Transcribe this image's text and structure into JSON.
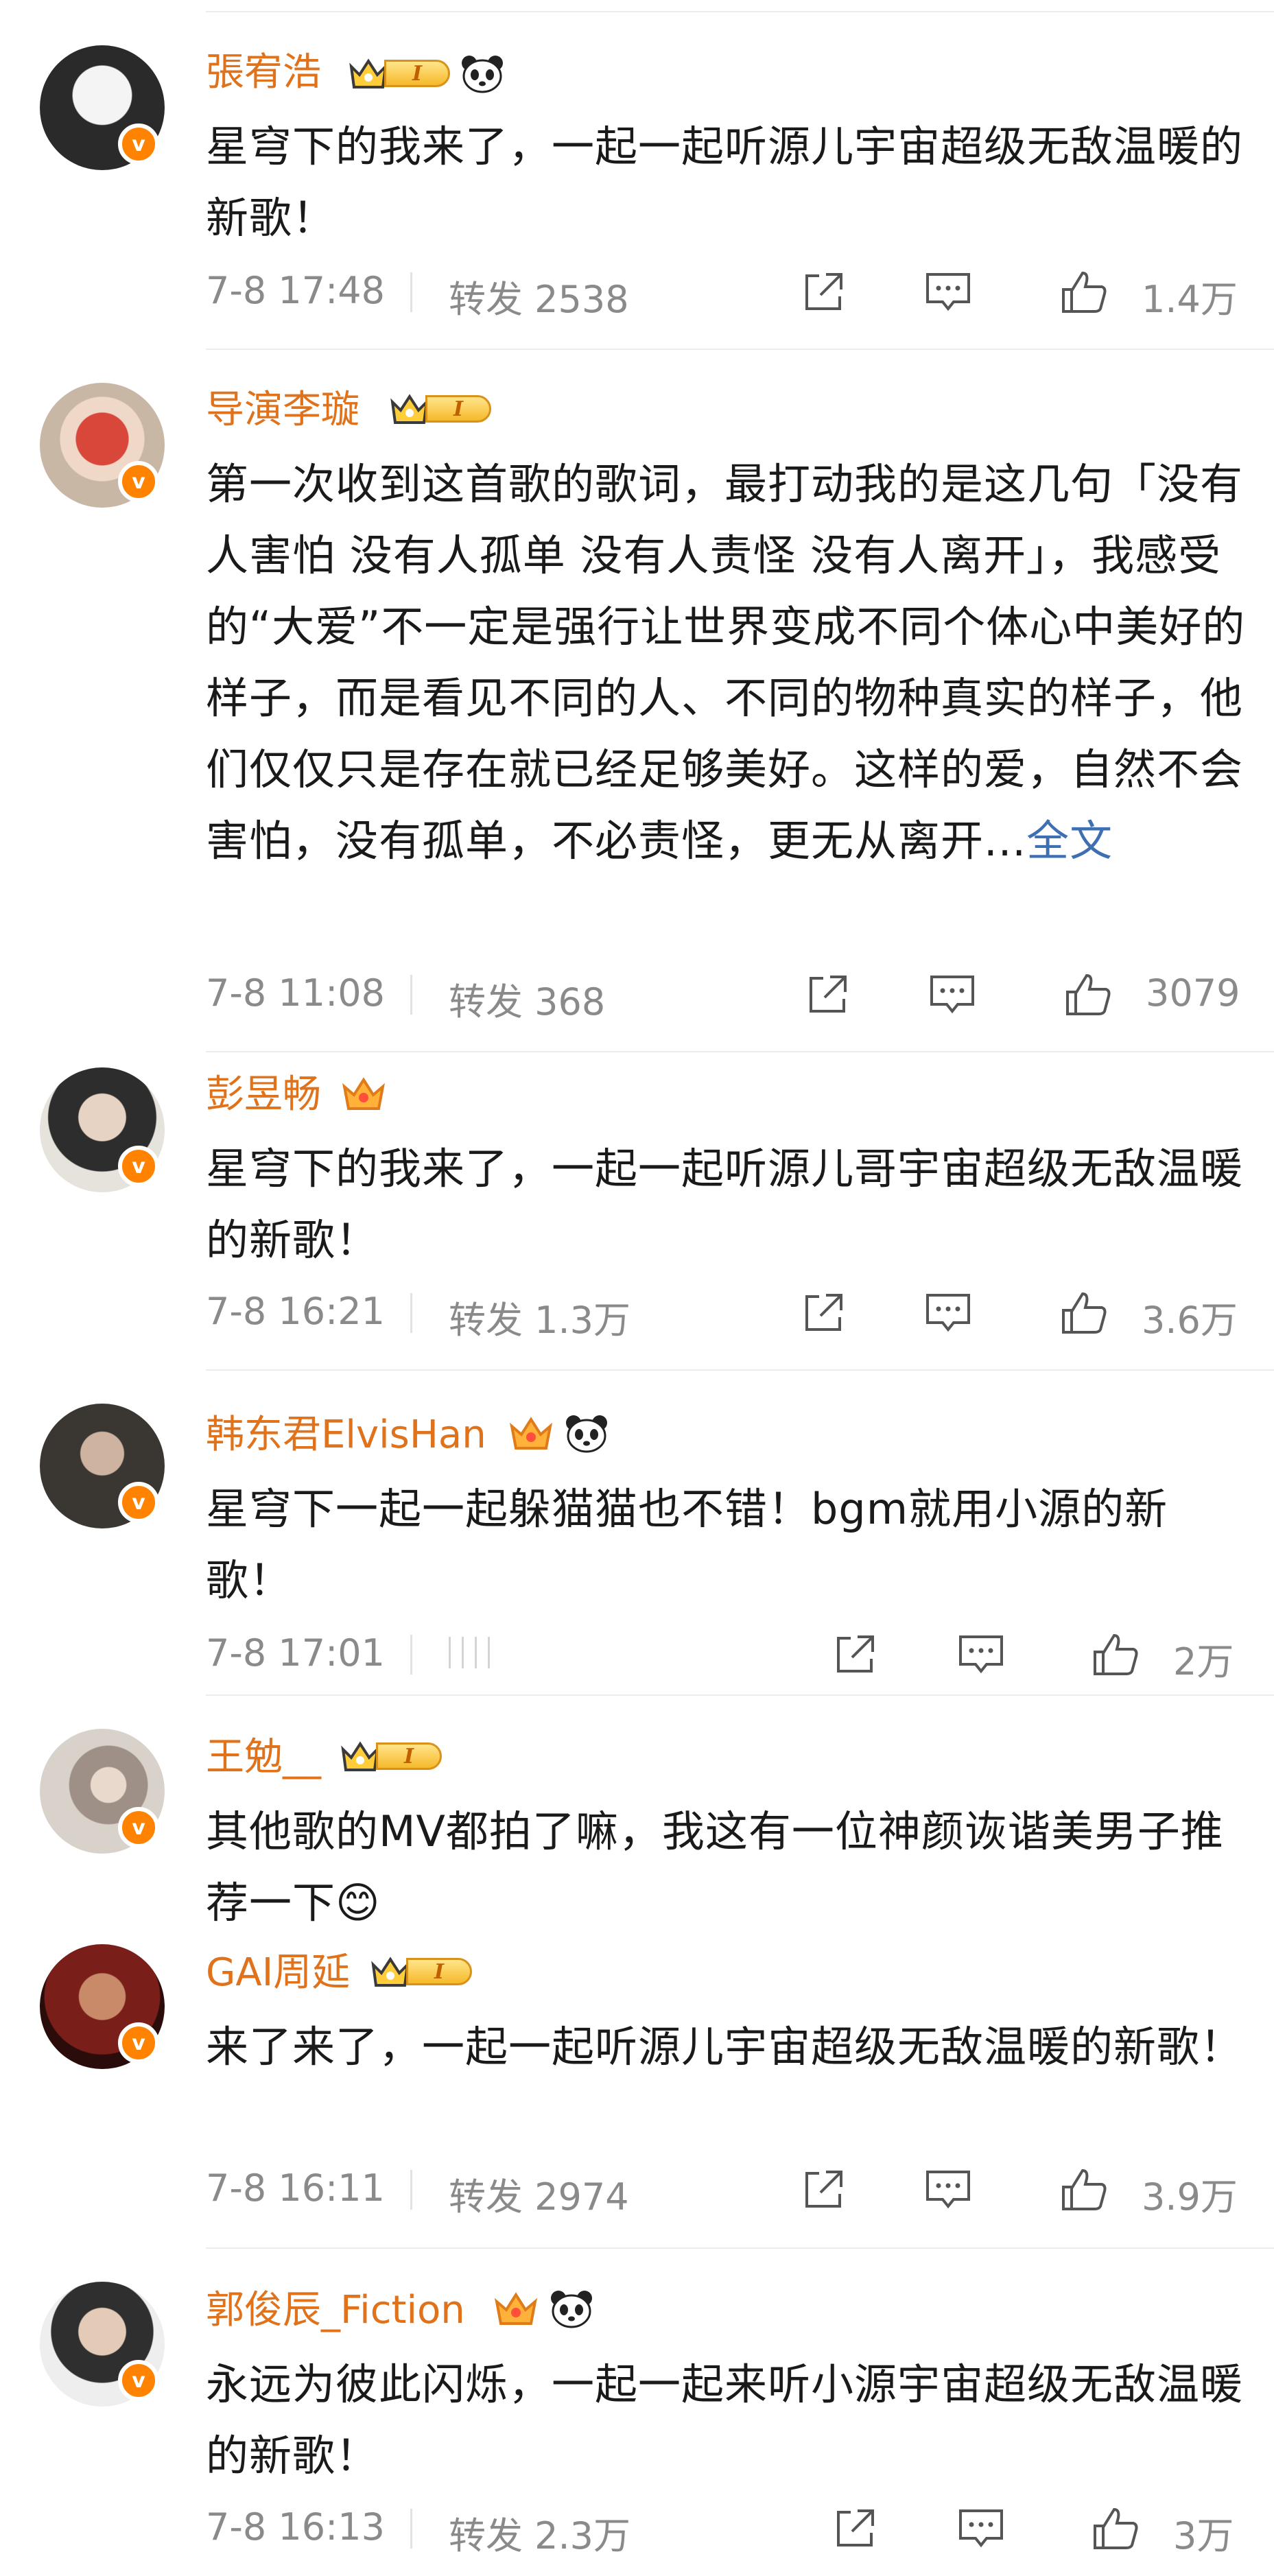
{
  "comments": [
    {
      "name": "張宥浩",
      "badge": "I",
      "panda": true,
      "text": "星穹下的我来了，一起一起听源儿宇宙超级无敌温暖的新歌！",
      "time": "7-8 17:48",
      "repost": "转发 2538",
      "likes": "1.4万"
    },
    {
      "name": "导演李璇",
      "badge": "I",
      "panda": false,
      "text": "第一次收到这首歌的歌词，最打动我的是这几句「没有人害怕 没有人孤单 没有人责怪 没有人离开」，我感受的“大爱”不一定是强行让世界变成不同个体心中美好的样子，而是看见不同的人、不同的物种真实的样子，他们仅仅只是存在就已经足够美好。这样的爱，自然不会害怕，没有孤单，不必责怪，更无从离开...",
      "more": "全文",
      "time": "7-8 11:08",
      "repost": "转发 368",
      "likes": "3079"
    },
    {
      "name": "彭昱畅",
      "badge": "",
      "panda": false,
      "text": "星穹下的我来了，一起一起听源儿哥宇宙超级无敌温暖的新歌！",
      "time": "7-8 16:21",
      "repost": "转发 1.3万",
      "likes": "3.6万"
    },
    {
      "name": "韩东君ElvisHan",
      "badge": "",
      "panda": true,
      "text": "星穹下一起一起躲猫猫也不错！bgm就用小源的新歌！",
      "time": "7-8 17:01",
      "repost": "",
      "likes": "2万"
    },
    {
      "name": "王勉__",
      "badge": "I",
      "panda": false,
      "text": "其他歌的MV都拍了嘛，我这有一位神颜诙谐美男子推荐一下😊"
    },
    {
      "name": "GAI周延",
      "badge": "I",
      "panda": false,
      "text": "来了来了，一起一起听源儿宇宙超级无敌温暖的新歌！",
      "time": "7-8 16:11",
      "repost": "转发 2974",
      "likes": "3.9万"
    },
    {
      "name": "郭俊辰_Fiction",
      "badge": "",
      "panda": true,
      "text": "永远为彼此闪烁，一起一起来听小源宇宙超级无敌温暖的新歌！",
      "time": "7-8 16:13",
      "repost": "转发 2.3万",
      "likes": "3万"
    }
  ],
  "verified_mark": "v",
  "colors": {
    "name": "#e0721b",
    "meta": "#8a8a8a",
    "link": "#3f6fb3",
    "verified": "#ff8200"
  }
}
